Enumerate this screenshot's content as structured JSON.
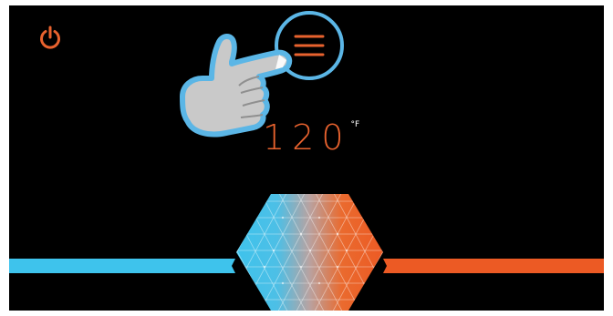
{
  "screen": {
    "background": "#000000"
  },
  "power_button": {
    "icon": "power-icon",
    "color": "#e8622e"
  },
  "menu_button": {
    "icon": "hamburger-menu-icon",
    "color": "#e8622e",
    "highlight_ring_color": "#5bb6e6"
  },
  "hint": {
    "icon": "pointing-hand-icon"
  },
  "temperature": {
    "value": "120",
    "unit": "°F",
    "color": "#e8622e"
  },
  "slider": {
    "cold_color": "#3ec3ec",
    "hot_color": "#ec5a24",
    "handle_icon": "hexagon-thermostat-handle"
  }
}
